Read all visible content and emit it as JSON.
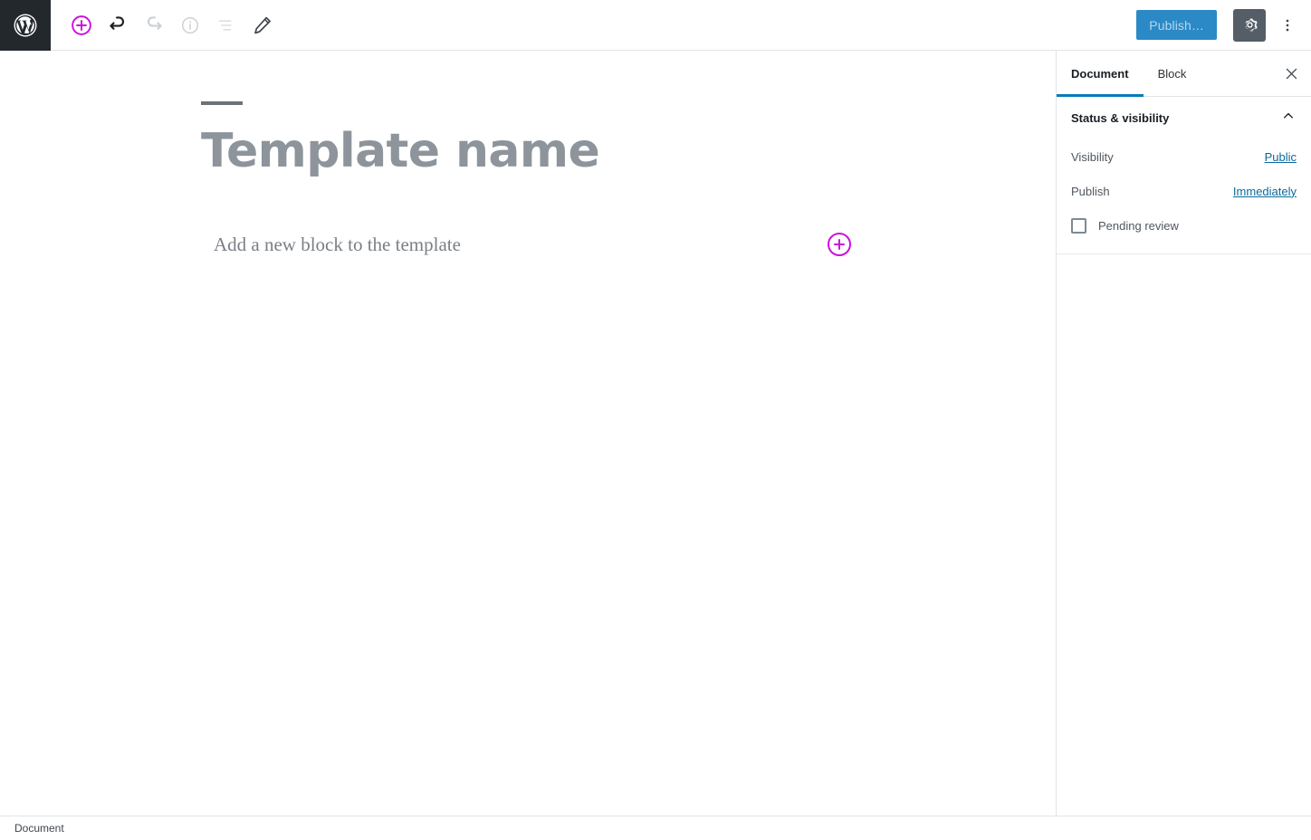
{
  "header": {
    "logo_icon": "wordpress-logo-icon",
    "tools": [
      {
        "name": "add-block-button",
        "icon": "plus-circle-icon",
        "state": "enabled",
        "color": "#cc11dd"
      },
      {
        "name": "undo-button",
        "icon": "undo-arrow-icon",
        "state": "enabled",
        "color": "#1e1e1e"
      },
      {
        "name": "redo-button",
        "icon": "redo-arrow-icon",
        "state": "disabled",
        "color": "#ccd0d4"
      },
      {
        "name": "content-info-button",
        "icon": "info-circle-icon",
        "state": "disabled",
        "color": "#ccd0d4"
      },
      {
        "name": "list-view-button",
        "icon": "list-view-icon",
        "state": "disabled",
        "color": "#dcdfe2"
      },
      {
        "name": "edit-mode-button",
        "icon": "pencil-icon",
        "state": "enabled",
        "color": "#40464d"
      }
    ],
    "publish_label": "Publish…",
    "publish_bg": "#2b8ac6",
    "publish_text_color": "#b5d7ec",
    "settings_icon": "gear-icon",
    "settings_bg": "#555d66",
    "more_menu_icon": "kebab-vertical-icon"
  },
  "editor": {
    "title_placeholder": "Template name",
    "appender_text": "Add a new block to the template",
    "appender_icon": "plus-circle-icon",
    "accent_color": "#cc11dd"
  },
  "sidebar": {
    "tabs": [
      {
        "label": "Document",
        "active": true
      },
      {
        "label": "Block",
        "active": false
      }
    ],
    "close_icon": "close-icon",
    "active_tab_underline": "#007cba",
    "panel": {
      "title": "Status & visibility",
      "collapse_icon": "chevron-up-icon",
      "rows": [
        {
          "label": "Visibility",
          "value": "Public"
        },
        {
          "label": "Publish",
          "value": "Immediately"
        }
      ],
      "checkbox": {
        "label": "Pending review",
        "checked": false
      }
    }
  },
  "footer": {
    "breadcrumb": "Document"
  }
}
